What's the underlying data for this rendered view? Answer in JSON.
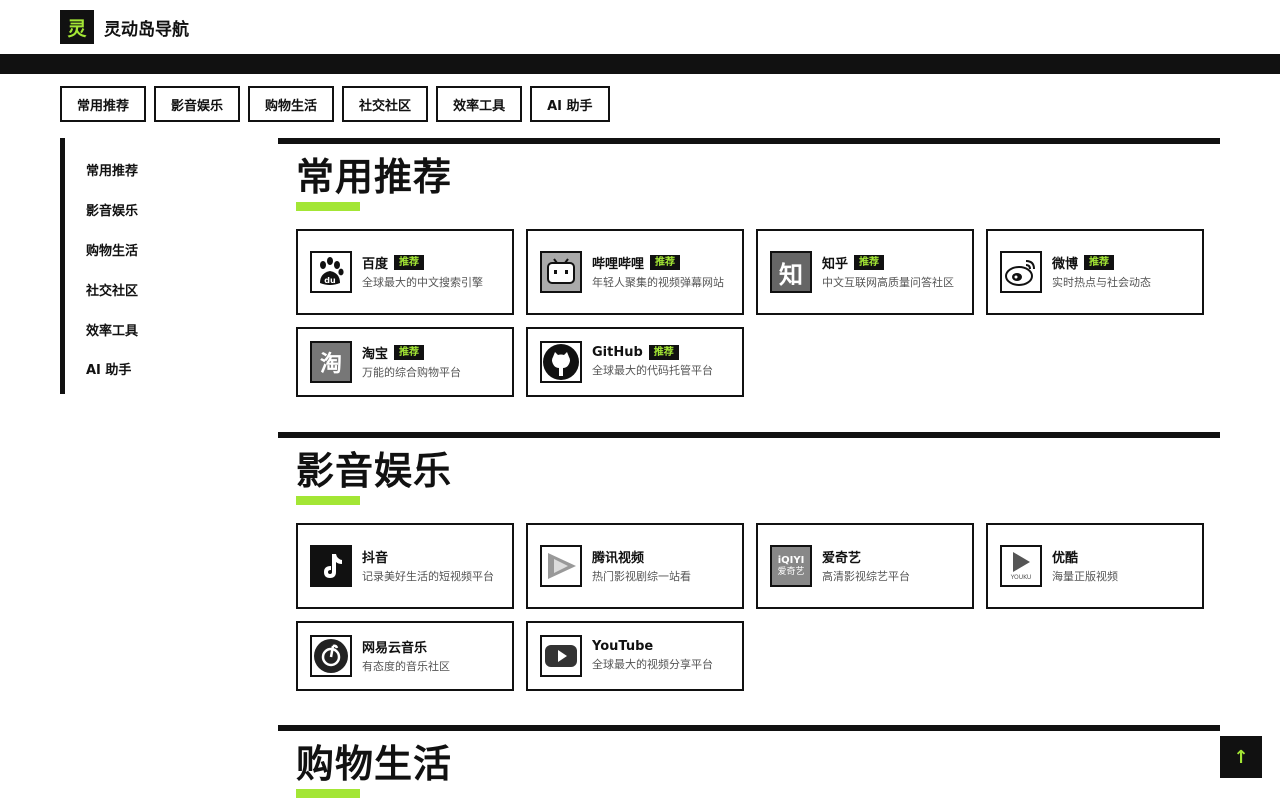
{
  "header": {
    "logo_char": "灵",
    "title": "灵动岛导航"
  },
  "tabs": [
    "常用推荐",
    "影音娱乐",
    "购物生活",
    "社交社区",
    "效率工具",
    "AI 助手"
  ],
  "sidebar": [
    "常用推荐",
    "影音娱乐",
    "购物生活",
    "社交社区",
    "效率工具",
    "AI 助手"
  ],
  "sections": [
    {
      "title": "常用推荐",
      "cards": [
        {
          "name": "百度",
          "badge": "推荐",
          "desc": "全球最大的中文搜索引擎",
          "icon": "baidu-icon"
        },
        {
          "name": "哔哩哔哩",
          "badge": "推荐",
          "desc": "年轻人聚集的视频弹幕网站",
          "icon": "bilibili-icon"
        },
        {
          "name": "知乎",
          "badge": "推荐",
          "desc": "中文互联网高质量问答社区",
          "icon": "zhihu-icon"
        },
        {
          "name": "微博",
          "badge": "推荐",
          "desc": "实时热点与社会动态",
          "icon": "weibo-icon"
        },
        {
          "name": "淘宝",
          "badge": "推荐",
          "desc": "万能的综合购物平台",
          "icon": "taobao-icon"
        },
        {
          "name": "GitHub",
          "badge": "推荐",
          "desc": "全球最大的代码托管平台",
          "icon": "github-icon"
        }
      ]
    },
    {
      "title": "影音娱乐",
      "cards": [
        {
          "name": "抖音",
          "desc": "记录美好生活的短视频平台",
          "icon": "douyin-icon"
        },
        {
          "name": "腾讯视频",
          "desc": "热门影视剧综一站看",
          "icon": "tencent-video-icon"
        },
        {
          "name": "爱奇艺",
          "desc": "高清影视综艺平台",
          "icon": "iqiyi-icon"
        },
        {
          "name": "优酷",
          "desc": "海量正版视频",
          "icon": "youku-icon"
        },
        {
          "name": "网易云音乐",
          "desc": "有态度的音乐社区",
          "icon": "netease-music-icon"
        },
        {
          "name": "YouTube",
          "desc": "全球最大的视频分享平台",
          "icon": "youtube-icon"
        }
      ]
    },
    {
      "title": "购物生活"
    }
  ],
  "icon_text": {
    "zhihu": "知",
    "taobao": "淘",
    "iqiyi_top": "iQIYI",
    "iqiyi_bottom": "爱奇艺",
    "youku": "YOUKU"
  },
  "back_to_top": "↑",
  "colors": {
    "accent": "#a3e635",
    "ink": "#111111"
  }
}
